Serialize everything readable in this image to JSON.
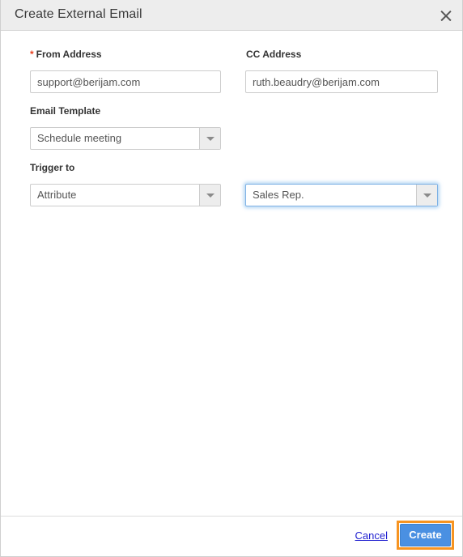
{
  "dialog": {
    "title": "Create External Email",
    "close_icon": "close-icon"
  },
  "form": {
    "from_address": {
      "label": "From Address",
      "required_marker": "*",
      "value": "support@berijam.com"
    },
    "cc_address": {
      "label": "CC Address",
      "value": "ruth.beaudry@berijam.com"
    },
    "email_template": {
      "label": "Email Template",
      "value": "Schedule meeting",
      "arrow_icon": "chevron-down-icon"
    },
    "trigger_to": {
      "label": "Trigger to",
      "value": "Attribute",
      "arrow_icon": "chevron-down-icon"
    },
    "trigger_target": {
      "value": "Sales Rep.",
      "arrow_icon": "chevron-down-icon",
      "focused": true
    }
  },
  "footer": {
    "cancel_label": "Cancel",
    "create_label": "Create"
  },
  "colors": {
    "accent_blue": "#4a90e2",
    "highlight_orange": "#f79421",
    "required_red": "#e8401f",
    "link_blue": "#2020d0",
    "titlebar_bg": "#ededed"
  }
}
